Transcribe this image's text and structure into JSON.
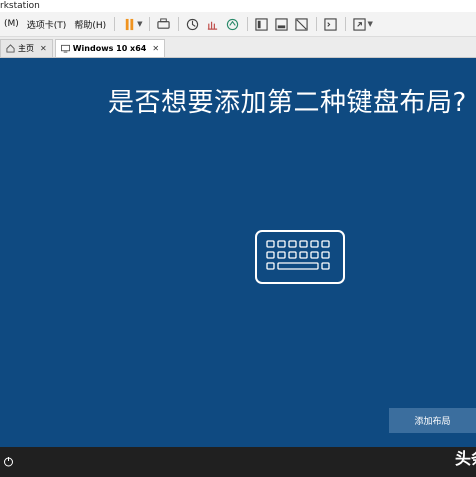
{
  "window": {
    "title": "rkstation"
  },
  "menu": {
    "items": [
      "(M)",
      "选项卡(T)",
      "帮助(H)"
    ]
  },
  "tabs": [
    {
      "label": "主页",
      "close": "✕"
    },
    {
      "label": "Windows 10 x64",
      "close": "✕"
    }
  ],
  "vm": {
    "heading": "是否想要添加第二种键盘布局?",
    "button_label": "添加布局",
    "colors": {
      "background": "#0f4a81",
      "button": "#3b6e9e"
    }
  },
  "statusbar": {
    "watermark": "头条"
  },
  "icons": {
    "toolbar": [
      "pause-icon",
      "send-keys-icon",
      "snapshot-icon",
      "revert-snapshot-icon",
      "snapshot-manager-icon",
      "view-normal-icon",
      "view-unity-icon",
      "view-hide-icon",
      "console-icon",
      "fullscreen-icon"
    ]
  }
}
